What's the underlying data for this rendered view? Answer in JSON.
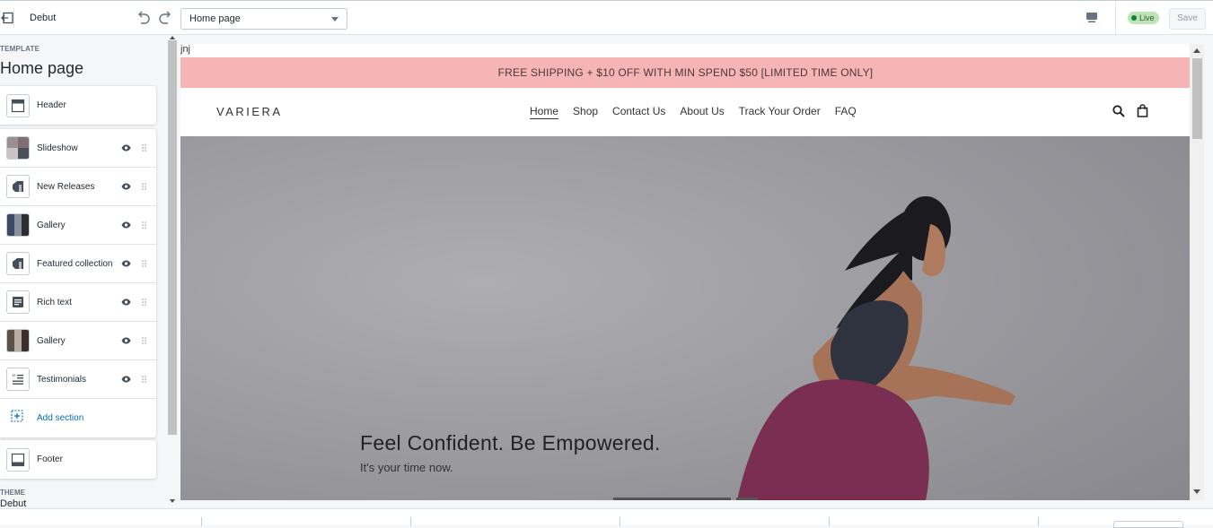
{
  "topbar": {
    "theme_name": "Debut",
    "page_select": "Home page",
    "status": "Live",
    "save_label": "Save"
  },
  "sidebar": {
    "template_label": "TEMPLATE",
    "page_title": "Home page",
    "header_item": {
      "label": "Header",
      "icon": "header-layout-icon"
    },
    "sections": [
      {
        "label": "Slideshow",
        "icon": "slideshow-thumbnail"
      },
      {
        "label": "New Releases",
        "icon": "collection-tag-icon"
      },
      {
        "label": "Gallery",
        "icon": "gallery-thumbnail"
      },
      {
        "label": "Featured collection",
        "icon": "collection-tag-icon"
      },
      {
        "label": "Rich text",
        "icon": "text-block-icon"
      },
      {
        "label": "Gallery",
        "icon": "gallery-thumbnail"
      },
      {
        "label": "Testimonials",
        "icon": "quote-icon"
      }
    ],
    "add_section": "Add section",
    "footer_item": {
      "label": "Footer",
      "icon": "footer-layout-icon"
    },
    "theme_label": "THEME",
    "theme_value": "Debut"
  },
  "preview": {
    "stray_text": "jnj",
    "announcement": "FREE SHIPPING + $10 OFF WITH MIN SPEND $50 [LIMITED TIME ONLY]",
    "logo": "VARIERA",
    "nav": [
      "Home",
      "Shop",
      "Contact Us",
      "About Us",
      "Track Your Order",
      "FAQ"
    ],
    "hero_heading": "Feel Confident. Be Empowered.",
    "hero_subheading": "It's your time now."
  },
  "colors": {
    "announcement_bg": "#f7b4b4",
    "live_badge": "#bbe5b3",
    "link": "#006fbb"
  }
}
